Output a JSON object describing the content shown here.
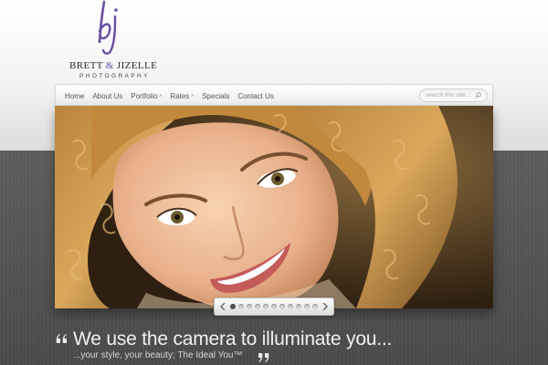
{
  "brand": {
    "name_part1": "BRETT",
    "name_amp": "&",
    "name_part2": "JIZELLE",
    "subtitle": "PHOTOGRAPHY",
    "logo_mark": "bj-monogram-logo",
    "accent_color": "#6a4fa3"
  },
  "nav": {
    "items": [
      {
        "label": "Home",
        "has_submenu": false
      },
      {
        "label": "About Us",
        "has_submenu": false
      },
      {
        "label": "Portfolio",
        "has_submenu": true
      },
      {
        "label": "Rates",
        "has_submenu": true
      },
      {
        "label": "Specials",
        "has_submenu": false
      },
      {
        "label": "Contact Us",
        "has_submenu": false
      }
    ],
    "submenu_arrow": "»",
    "search_placeholder": "search this site...",
    "search_icon": "search-icon"
  },
  "slider": {
    "image": "portrait-curly-haired-woman-smiling",
    "slide_count": 11,
    "active_slide": 1,
    "prev_icon": "chevron-left-icon",
    "next_icon": "chevron-right-icon"
  },
  "tagline": {
    "main": "We use the camera to illuminate you...",
    "sub": "...your style, your beauty; The Ideal You™",
    "quote_icon": "quote-icon"
  }
}
